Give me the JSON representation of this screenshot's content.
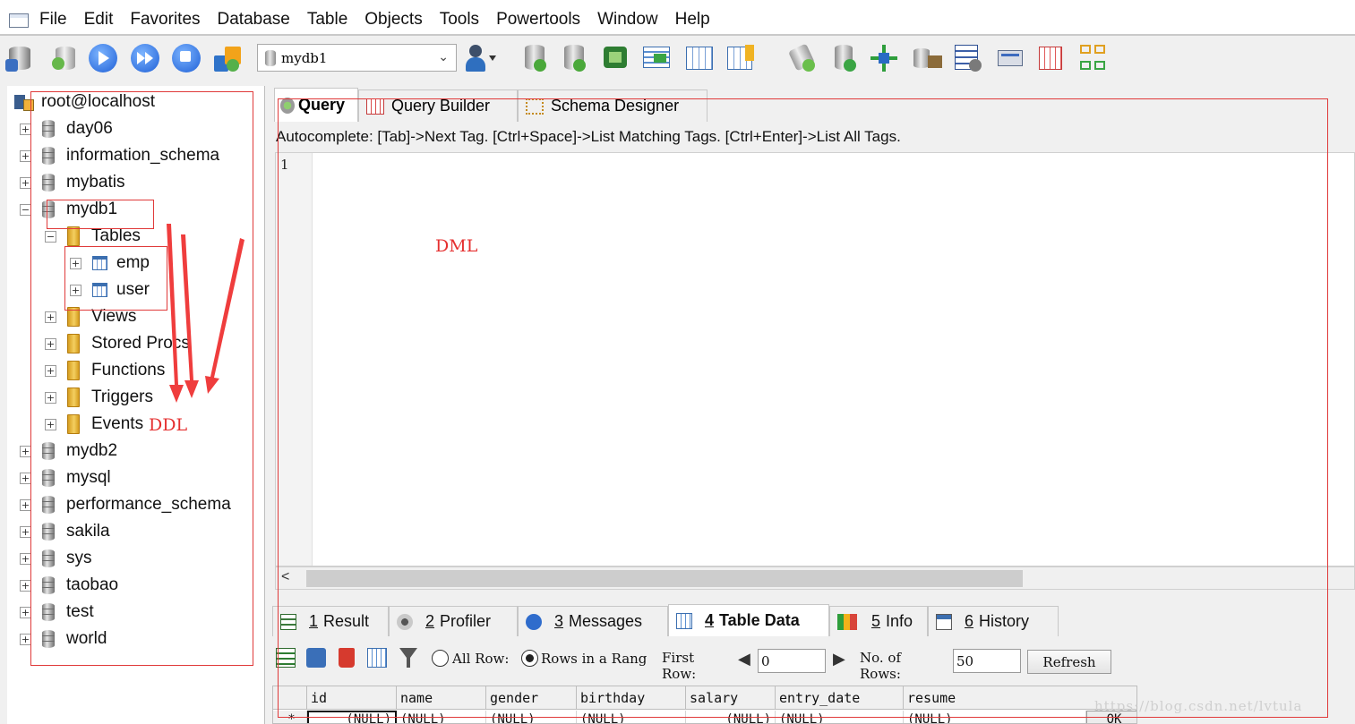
{
  "menu": {
    "items": [
      "File",
      "Edit",
      "Favorites",
      "Database",
      "Table",
      "Objects",
      "Tools",
      "Powertools",
      "Window",
      "Help"
    ]
  },
  "toolbar": {
    "selected_database": "mydb1"
  },
  "object_browser": {
    "root": "root@localhost",
    "databases": [
      "day06",
      "information_schema",
      "mybatis",
      "mydb1",
      "mydb2",
      "mysql",
      "performance_schema",
      "sakila",
      "sys",
      "taobao",
      "test",
      "world"
    ],
    "expanded_database": "mydb1",
    "tables_folder": "Tables",
    "tables": [
      "emp",
      "user"
    ],
    "other_folders": [
      "Views",
      "Stored Procs",
      "Functions",
      "Triggers",
      "Events"
    ]
  },
  "editor_tabs": [
    "Query",
    "Query Builder",
    "Schema Designer"
  ],
  "autocomplete_hint": "Autocomplete: [Tab]->Next Tag. [Ctrl+Space]->List Matching Tags. [Ctrl+Enter]->List All Tags.",
  "editor": {
    "line_number": "1"
  },
  "results_tabs": [
    {
      "key": "1",
      "label": "Result"
    },
    {
      "key": "2",
      "label": "Profiler"
    },
    {
      "key": "3",
      "label": "Messages"
    },
    {
      "key": "4",
      "label": "Table Data"
    },
    {
      "key": "5",
      "label": "Info"
    },
    {
      "key": "6",
      "label": "History"
    }
  ],
  "data_controls": {
    "all_rows_label": "All Row:",
    "range_label": "Rows in a Rang",
    "first_row_label_1": "First",
    "first_row_label_2": "Row:",
    "first_row_value": "0",
    "rows_count_label_1": "No. of",
    "rows_count_label_2": "Rows:",
    "rows_count_value": "50",
    "refresh_label": "Refresh"
  },
  "grid": {
    "columns": [
      "id",
      "name",
      "gender",
      "birthday",
      "salary",
      "entry_date",
      "resume"
    ],
    "new_row_marker": "*",
    "new_row": [
      "(NULL)",
      "(NULL)",
      "(NULL)",
      "(NULL)",
      "(NULL)",
      "(NULL)",
      "(NULL)"
    ],
    "ok_label": "OK"
  },
  "annotations": {
    "dml_label": "DML",
    "ddl_label": "DDL",
    "annotation_color": "#e53030",
    "watermark": "https://blog.csdn.net/lvtula"
  }
}
